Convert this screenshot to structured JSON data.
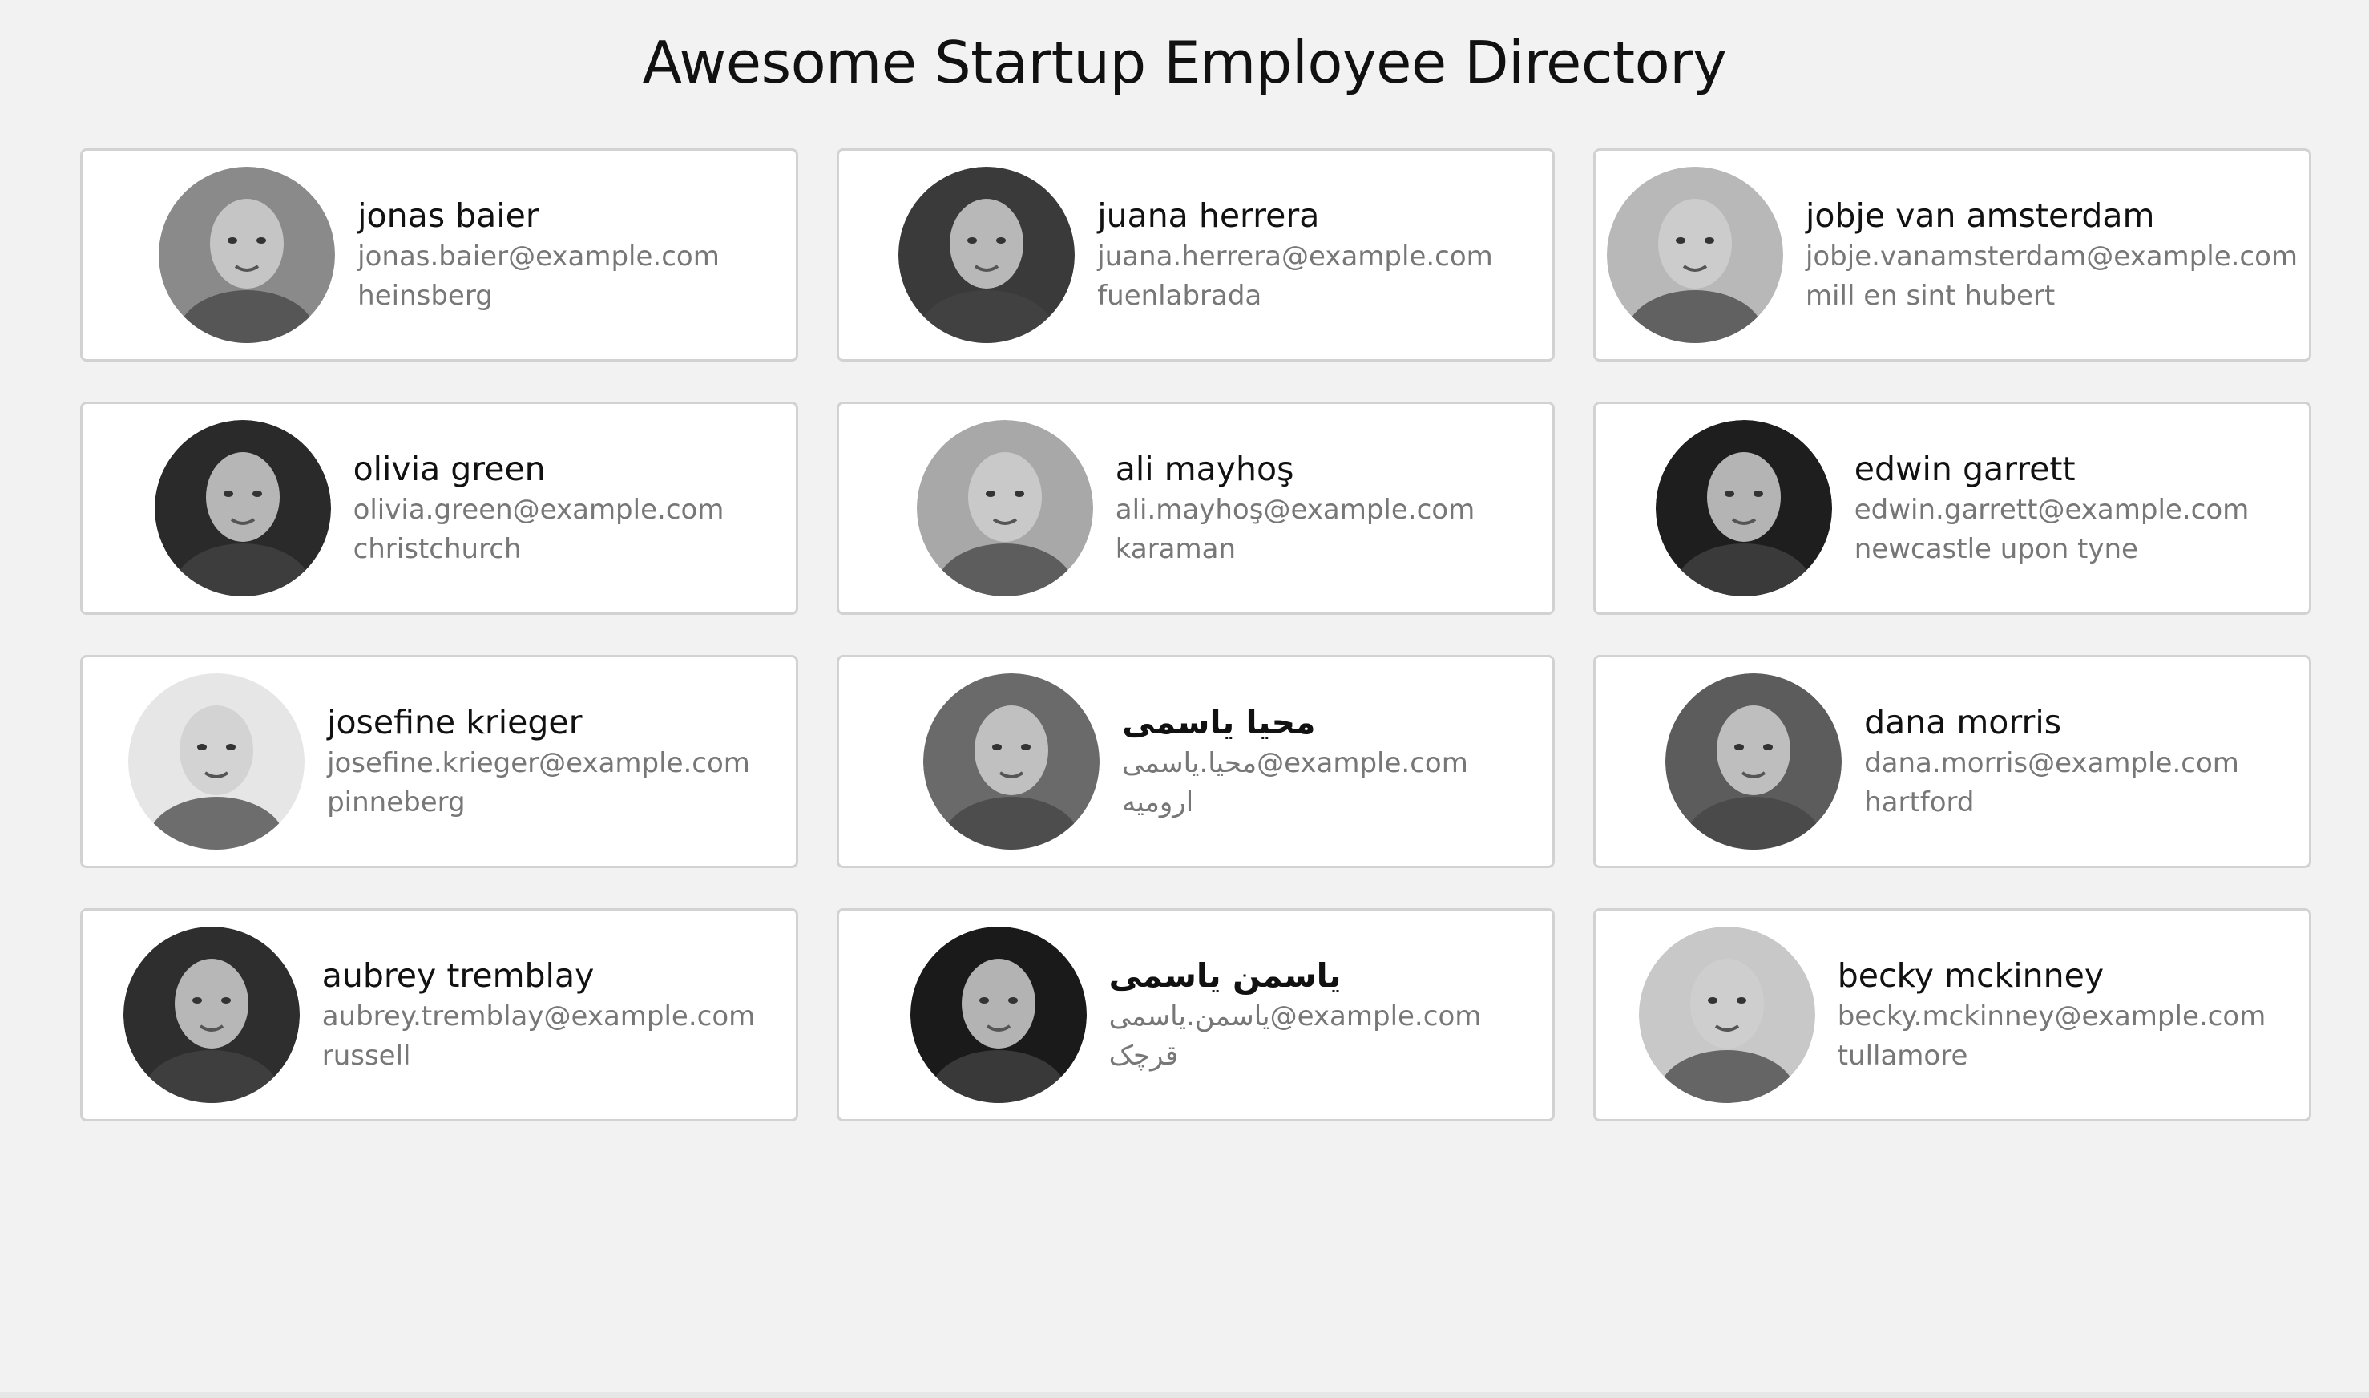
{
  "page": {
    "title": "Awesome Startup Employee Directory"
  },
  "employees": [
    {
      "name": "jonas baier",
      "email": "jonas.baier@example.com",
      "city": "heinsberg",
      "tone": "#8a8a8a"
    },
    {
      "name": "juana herrera",
      "email": "juana.herrera@example.com",
      "city": "fuenlabrada",
      "tone": "#3a3a3a"
    },
    {
      "name": "jobje van amsterdam",
      "email": "jobje.vanamsterdam@example.com",
      "city": "mill en sint hubert",
      "tone": "#b8b8b8"
    },
    {
      "name": "olivia green",
      "email": "olivia.green@example.com",
      "city": "christchurch",
      "tone": "#2a2a2a"
    },
    {
      "name": "ali mayhoş",
      "email": "ali.mayhoş@example.com",
      "city": "karaman",
      "tone": "#a8a8a8"
    },
    {
      "name": "edwin garrett",
      "email": "edwin.garrett@example.com",
      "city": "newcastle upon tyne",
      "tone": "#1e1e1e"
    },
    {
      "name": "josefine krieger",
      "email": "josefine.krieger@example.com",
      "city": "pinneberg",
      "tone": "#e6e6e6"
    },
    {
      "name": "محیا یاسمی",
      "email": "محیا.یاسمی@example.com",
      "city": "ارومیه",
      "tone": "#6a6a6a"
    },
    {
      "name": "dana morris",
      "email": "dana.morris@example.com",
      "city": "hartford",
      "tone": "#5c5c5c"
    },
    {
      "name": "aubrey tremblay",
      "email": "aubrey.tremblay@example.com",
      "city": "russell",
      "tone": "#2e2e2e"
    },
    {
      "name": "یاسمن یاسمی",
      "email": "یاسمن.یاسمی@example.com",
      "city": "قرچک",
      "tone": "#1a1a1a"
    },
    {
      "name": "becky mckinney",
      "email": "becky.mckinney@example.com",
      "city": "tullamore",
      "tone": "#c8c8c8"
    }
  ]
}
